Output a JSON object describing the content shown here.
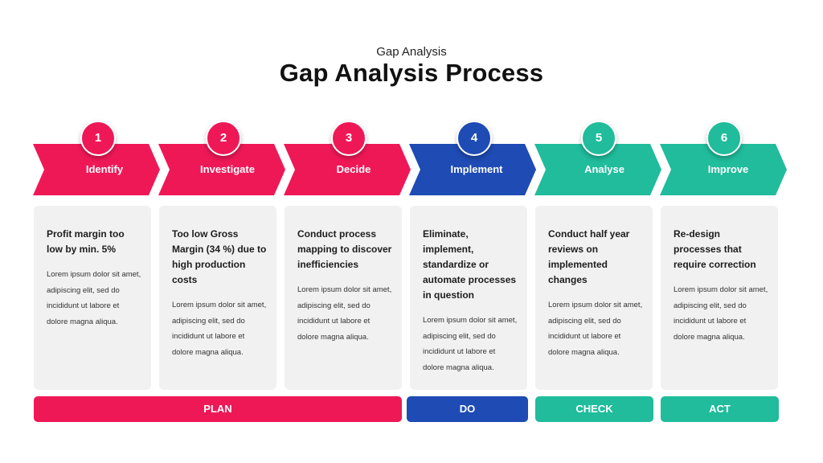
{
  "header": {
    "subtitle": "Gap Analysis",
    "title": "Gap Analysis Process"
  },
  "colors": {
    "plan": "#ef1857",
    "do": "#1e4bb4",
    "check_act": "#20bc9c",
    "card_bg": "#f1f1f1"
  },
  "steps": [
    {
      "number": "1",
      "label": "Identify",
      "color": "#ef1857",
      "heading": "Profit margin too low by min. 5%",
      "body": "Lorem ipsum dolor sit amet, adipiscing elit, sed do incididunt ut labore et dolore magna aliqua."
    },
    {
      "number": "2",
      "label": "Investigate",
      "color": "#ef1857",
      "heading": "Too low Gross Margin (34 %) due to high production costs",
      "body": "Lorem ipsum dolor sit amet, adipiscing elit, sed do incididunt ut labore et dolore magna aliqua."
    },
    {
      "number": "3",
      "label": "Decide",
      "color": "#ef1857",
      "heading": "Conduct process mapping to discover inefficiencies",
      "body": "Lorem ipsum dolor sit amet, adipiscing elit, sed do incididunt ut labore et dolore magna aliqua."
    },
    {
      "number": "4",
      "label": "Implement",
      "color": "#1e4bb4",
      "heading": "Eliminate, implement, standardize or automate processes in question",
      "body": "Lorem ipsum dolor sit amet, adipiscing elit, sed do incididunt ut labore et dolore magna aliqua."
    },
    {
      "number": "5",
      "label": "Analyse",
      "color": "#20bc9c",
      "heading": "Conduct half year reviews on implemented changes",
      "body": "Lorem ipsum dolor sit amet, adipiscing elit, sed do incididunt ut labore et dolore magna aliqua."
    },
    {
      "number": "6",
      "label": "Improve",
      "color": "#20bc9c",
      "heading": "Re-design processes that require correction",
      "body": "Lorem ipsum dolor sit amet, adipiscing elit, sed do incididunt ut labore et dolore magna aliqua."
    }
  ],
  "phases": [
    {
      "label": "PLAN",
      "color": "#ef1857"
    },
    {
      "label": "DO",
      "color": "#1e4bb4"
    },
    {
      "label": "CHECK",
      "color": "#20bc9c"
    },
    {
      "label": "ACT",
      "color": "#20bc9c"
    }
  ]
}
